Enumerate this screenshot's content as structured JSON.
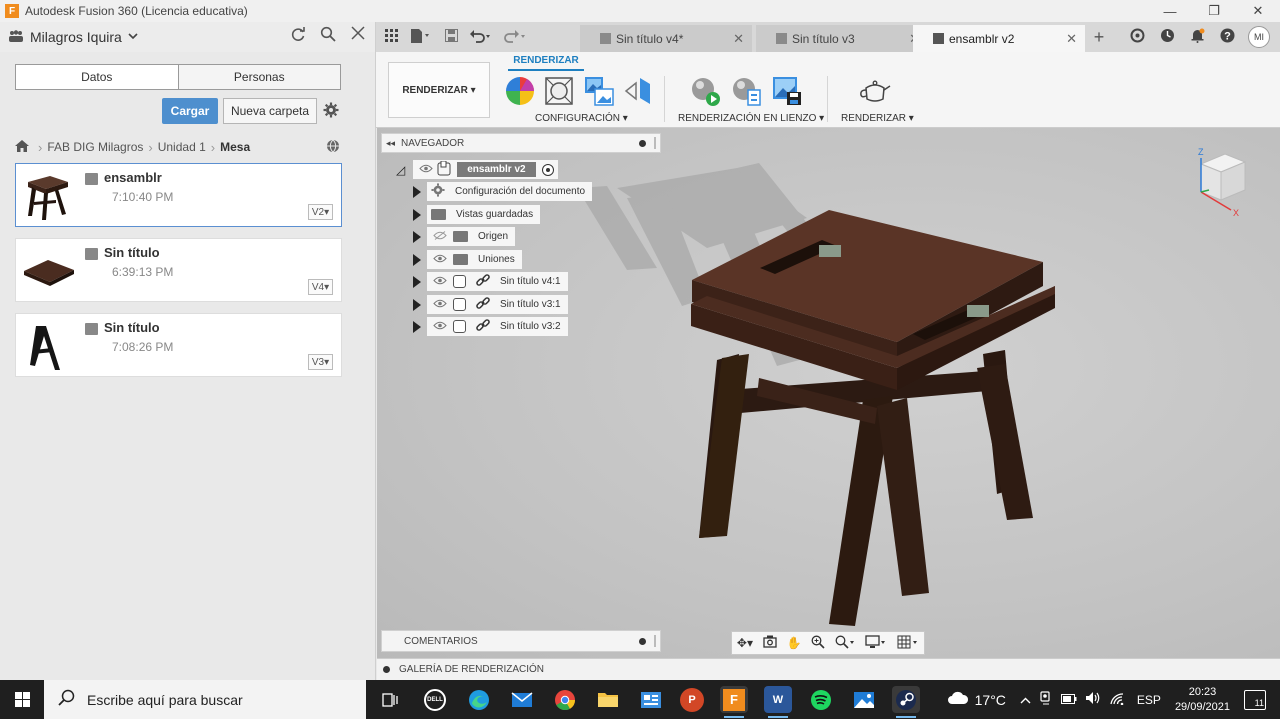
{
  "window": {
    "app_logo": "F",
    "title": "Autodesk Fusion 360 (Licencia educativa)",
    "controls": [
      "—",
      "❐",
      "✕"
    ]
  },
  "data_panel": {
    "user": "Milagros Iquira",
    "tabs": {
      "data": "Datos",
      "people": "Personas"
    },
    "upload_label": "Cargar",
    "new_folder_label": "Nueva carpeta",
    "breadcrumb": {
      "level1": "FAB DIG Milagros",
      "level2": "Unidad 1",
      "current": "Mesa"
    },
    "files": [
      {
        "name": "ensamblr",
        "time": "7:10:40 PM",
        "version": "V2"
      },
      {
        "name": "Sin título",
        "time": "6:39:13 PM",
        "version": "V4"
      },
      {
        "name": "Sin título",
        "time": "7:08:26 PM",
        "version": "V3"
      }
    ]
  },
  "tabs": [
    {
      "label": "Sin título v4*"
    },
    {
      "label": "Sin título v3"
    },
    {
      "label": "ensamblr v2"
    }
  ],
  "user_initials": "MI",
  "ribbon": {
    "workspace": "RENDERIZAR",
    "active_tab": "RENDERIZAR",
    "groups": {
      "setup": "CONFIGURACIÓN",
      "in_canvas": "RENDERIZACIÓN EN LIENZO",
      "render": "RENDERIZAR"
    }
  },
  "browser": {
    "title": "NAVEGADOR",
    "root": "ensamblr v2",
    "nodes": {
      "doc_settings": "Configuración del documento",
      "named_views": "Vistas guardadas",
      "origin": "Origen",
      "joints": "Uniones",
      "comp1": "Sin título v4:1",
      "comp2": "Sin título v3:1",
      "comp3": "Sin título v3:2"
    }
  },
  "viewcube": {
    "axis_z": "Z",
    "axis_x": "X"
  },
  "comments_label": "COMENTARIOS",
  "gallery_label": "GALERÍA DE RENDERIZACIÓN",
  "taskbar": {
    "search_placeholder": "Escribe aquí para buscar",
    "temperature": "17°C",
    "language": "ESP",
    "time": "20:23",
    "date": "29/09/2021",
    "notifications": "11",
    "apps": {
      "dell": "DELL",
      "powerpoint": "P",
      "fusion": "F",
      "word": "W"
    }
  },
  "colors": {
    "accent_blue": "#4e8fce",
    "ribbon_blue": "#1d7fc0",
    "wood": "#4a2c20",
    "taskbar": "#1f1f1f"
  }
}
